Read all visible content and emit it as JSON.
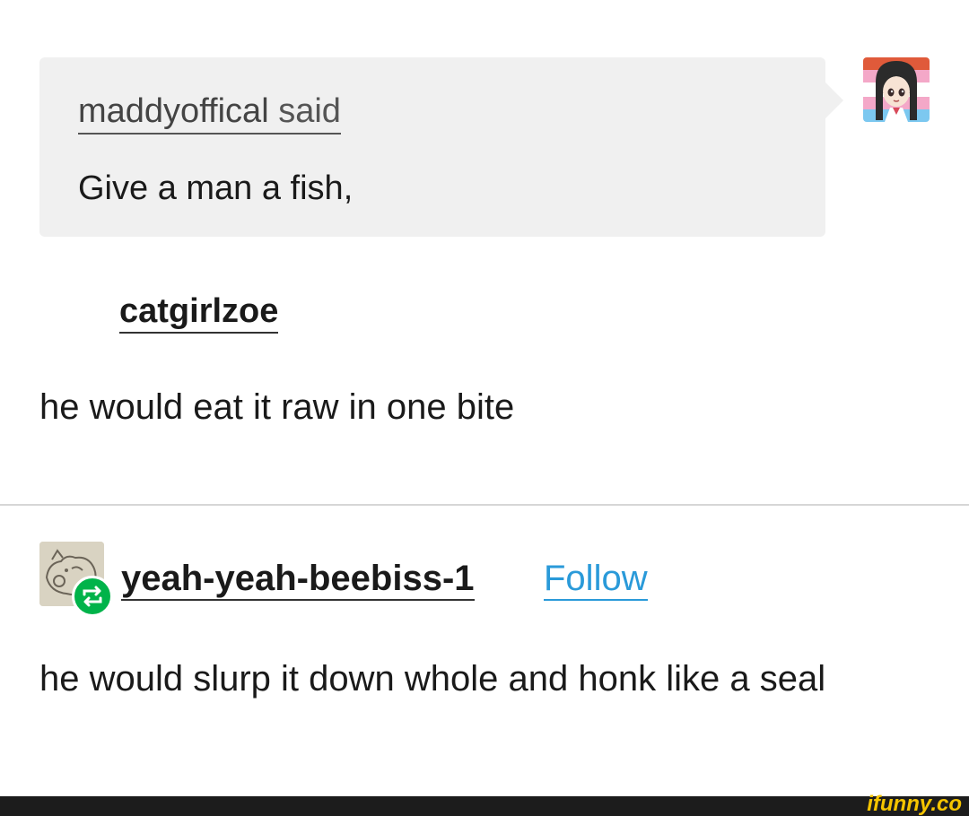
{
  "ask": {
    "asker_name": "maddyoffical",
    "said_label": "said",
    "question_text": "Give a man a fish,"
  },
  "reply1": {
    "username": "catgirlzoe",
    "text": "he would eat it raw in one bite"
  },
  "reply2": {
    "username": "yeah-yeah-beebiss-1",
    "follow_label": "Follow",
    "text": "he would slurp it down whole and honk like a seal"
  },
  "footer": {
    "watermark": "ifunny.co"
  },
  "icons": {
    "asker_avatar": "anime-girl-avatar-icon",
    "reblogger_avatar": "sketch-cow-avatar-icon",
    "reblog_badge": "reblog-icon"
  },
  "colors": {
    "ask_bubble": "#f0f0f0",
    "follow_link": "#2a9ad9",
    "reblog_badge": "#00b34a",
    "watermark": "#f5c400",
    "footer_bar": "#1c1c1c"
  }
}
